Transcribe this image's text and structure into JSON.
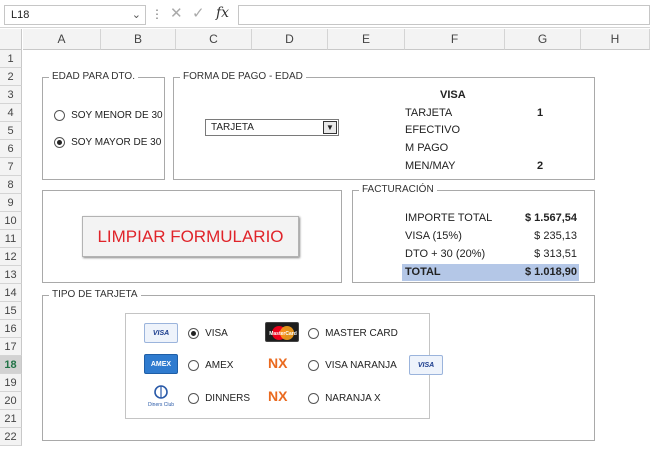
{
  "formula_bar": {
    "name_box": "L18",
    "menu_dots": "⋮",
    "cancel_symbol": "✕",
    "enter_symbol": "✓",
    "fx_label": "fx",
    "formula": ""
  },
  "columns": [
    "A",
    "B",
    "C",
    "D",
    "E",
    "F",
    "G",
    "H"
  ],
  "rows": [
    "1",
    "2",
    "3",
    "4",
    "5",
    "6",
    "7",
    "8",
    "9",
    "10",
    "11",
    "12",
    "13",
    "14",
    "15",
    "16",
    "17",
    "18",
    "19",
    "20",
    "21",
    "22"
  ],
  "selected_row": "18",
  "edad": {
    "title": "EDAD PARA DTO.",
    "options": [
      {
        "label": "SOY MENOR DE 30",
        "selected": false
      },
      {
        "label": "SOY MAYOR DE 30",
        "selected": true
      }
    ]
  },
  "forma_pago": {
    "title": "FORMA DE PAGO - EDAD",
    "dropdown_value": "TARJETA",
    "header": "VISA",
    "rows": [
      {
        "label": "TARJETA",
        "value": "1"
      },
      {
        "label": "EFECTIVO",
        "value": ""
      },
      {
        "label": "M PAGO",
        "value": ""
      },
      {
        "label": "MEN/MAY",
        "value": "2"
      }
    ]
  },
  "limpiar_button": "LIMPIAR FORMULARIO",
  "facturacion": {
    "title": "FACTURACIÓN",
    "rows": [
      {
        "label": "IMPORTE TOTAL",
        "value": "$ 1.567,54",
        "bold": true
      },
      {
        "label": "VISA (15%)",
        "value": "$ 235,13",
        "bold": false
      },
      {
        "label": "DTO + 30 (20%)",
        "value": "$ 313,51",
        "bold": false
      },
      {
        "label": "TOTAL",
        "value": "$ 1.018,90",
        "bold": true
      }
    ],
    "total_highlight": "#b4c7e7"
  },
  "tipo_tarjeta": {
    "title": "TIPO DE TARJETA",
    "options": [
      {
        "label": "VISA",
        "selected": true,
        "logo": "visa"
      },
      {
        "label": "MASTER CARD",
        "selected": false,
        "logo": "mastercard"
      },
      {
        "label": "AMEX",
        "selected": false,
        "logo": "amex"
      },
      {
        "label": "VISA NARANJA",
        "selected": false,
        "logo": "nx"
      },
      {
        "label": "DINNERS",
        "selected": false,
        "logo": "diners"
      },
      {
        "label": "NARANJA X",
        "selected": false,
        "logo": "nx"
      }
    ],
    "logo_text": {
      "visa": "VISA",
      "amex": "AMEX",
      "nx": "NX",
      "mastercard": "MasterCard",
      "diners": "Diners Club"
    }
  },
  "colors": {
    "button_text": "#e0242a",
    "nx_orange": "#ea6a1f",
    "excel_green": "#217346"
  }
}
